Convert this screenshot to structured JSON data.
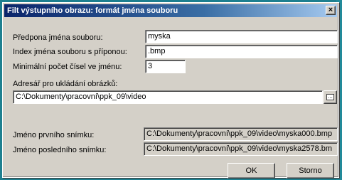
{
  "window": {
    "title": "Filt výstupního obrazu: formát jména souboru",
    "close_glyph": "×"
  },
  "form": {
    "prefix_label": "Předpona jména souboru:",
    "prefix_value": "myska",
    "index_label": "Index jména souboru s příponou:",
    "index_value": ".bmp",
    "min_digits_label": "Minimální počet čísel ve jménu:",
    "min_digits_value": "3",
    "dir_label": "Adresář pro ukládání obrázků:",
    "dir_value": "C:\\Dokumenty\\pracovní\\ppk_09\\video",
    "browse_glyph": "..."
  },
  "preview": {
    "first_label": "Jméno prvního snímku:",
    "first_value": "C:\\Dokumenty\\pracovní\\ppk_09\\video\\myska000.bmp",
    "last_label": "Jméno posledního snímku:",
    "last_value": "C:\\Dokumenty\\pracovní\\ppk_09\\video\\myska2578.bm"
  },
  "buttons": {
    "ok": "OK",
    "cancel": "Storno"
  }
}
